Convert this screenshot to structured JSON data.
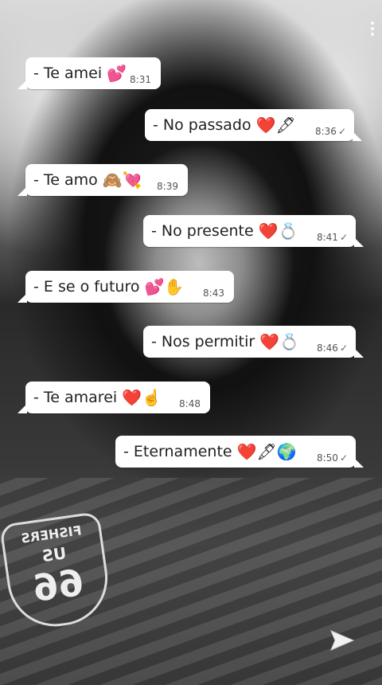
{
  "messages": [
    {
      "text": "- Te amei",
      "emoji": "💕",
      "time": "8:31",
      "side": "in",
      "check": ""
    },
    {
      "text": "- No passado",
      "emoji": "❤️🖋",
      "time": "8:36",
      "side": "out",
      "check": "✓"
    },
    {
      "text": "- Te amo",
      "emoji": "🙈💘",
      "time": "8:39",
      "side": "in",
      "check": ""
    },
    {
      "text": "- No presente",
      "emoji": "❤️💍",
      "time": "8:41",
      "side": "out",
      "check": "✓"
    },
    {
      "text": "- E se o futuro",
      "emoji": "💕✋",
      "time": "8:43",
      "side": "in",
      "check": ""
    },
    {
      "text": "- Nos permitir",
      "emoji": "❤️💍",
      "time": "8:46",
      "side": "out",
      "check": "✓"
    },
    {
      "text": "- Te amarei",
      "emoji": "❤️☝️",
      "time": "8:48",
      "side": "in",
      "check": ""
    },
    {
      "text": "- Eternamente",
      "emoji": "❤️🖋🌍",
      "time": "8:50",
      "side": "out",
      "check": "✓"
    }
  ],
  "background": {
    "badge_line1": "FISHERS",
    "badge_line2": "US",
    "badge_line3": "66"
  },
  "icons": {
    "send": "send-arrow-icon",
    "menu": "more-vertical-icon"
  },
  "colors": {
    "bubble": "#ffffff",
    "text": "#222222",
    "time": "#555555"
  }
}
